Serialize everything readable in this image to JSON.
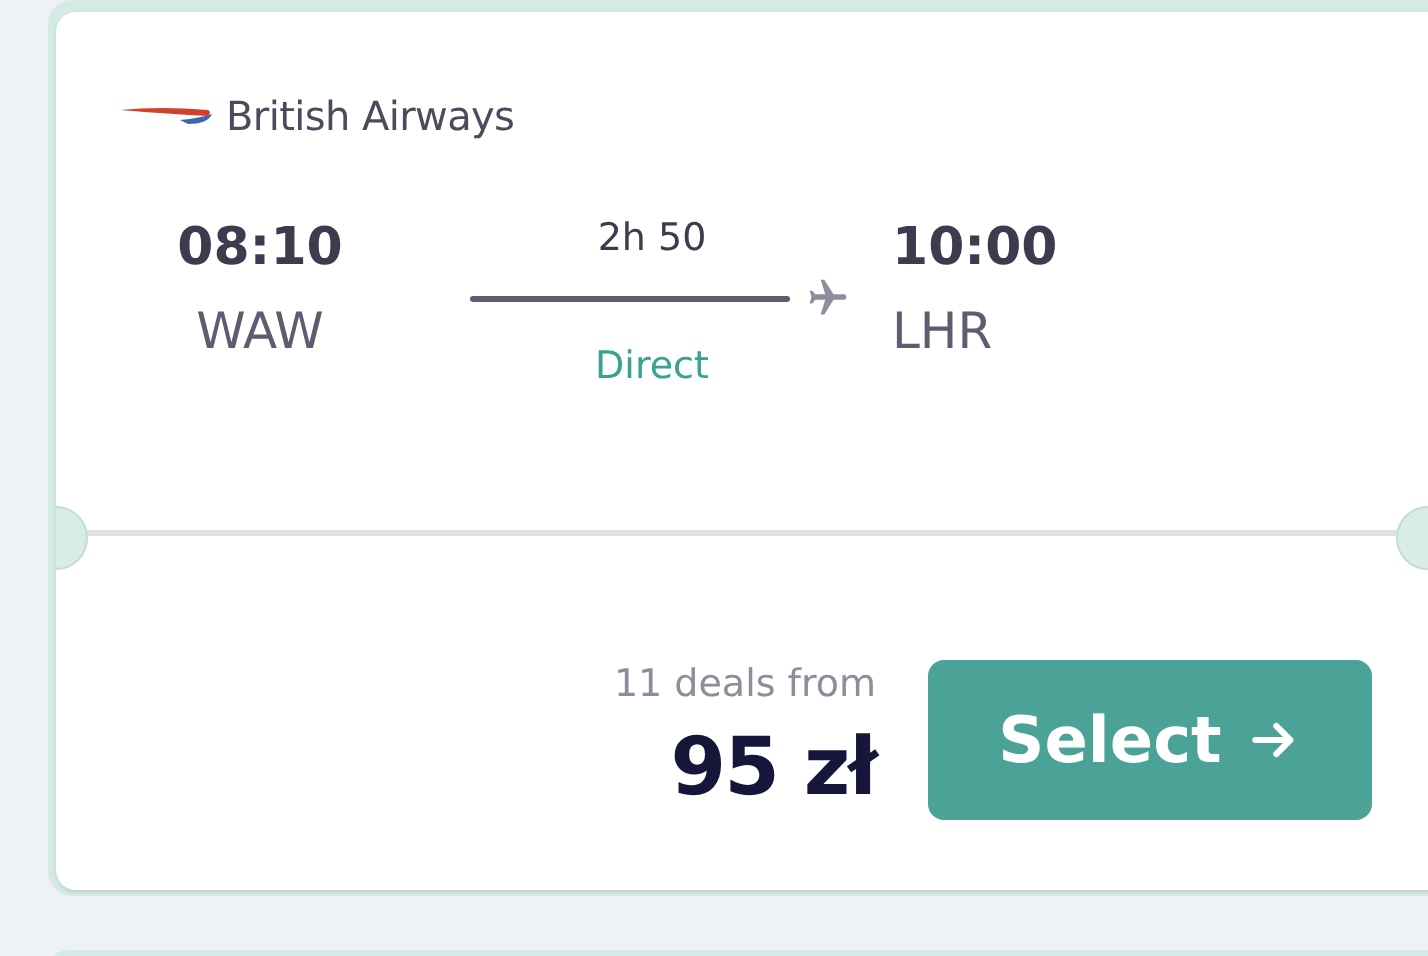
{
  "airline": {
    "name": "British Airways"
  },
  "departure": {
    "time": "08:10",
    "airport": "WAW"
  },
  "duration": "2h 50",
  "stops": "Direct",
  "arrival": {
    "time": "10:00",
    "airport": "LHR"
  },
  "deals": "11 deals from",
  "price": "95 zł",
  "select_button": {
    "label": "Select"
  }
}
